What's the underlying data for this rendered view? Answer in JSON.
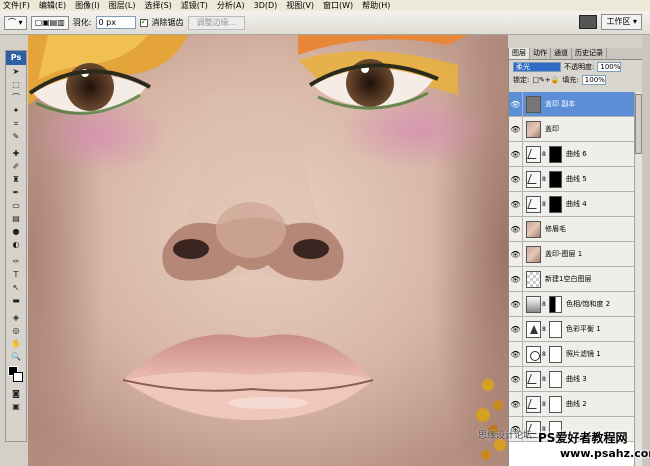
{
  "menu": [
    "文件(F)",
    "编辑(E)",
    "图像(I)",
    "图层(L)",
    "选择(S)",
    "滤镜(T)",
    "分析(A)",
    "3D(D)",
    "视图(V)",
    "窗口(W)",
    "帮助(H)"
  ],
  "options": {
    "feather_label": "羽化:",
    "feather_value": "0 px",
    "antialias_label": "消除锯齿",
    "refine_edge": "调整边缘..."
  },
  "workspace": {
    "label": "工作区 ▾"
  },
  "toolbox": {
    "logo": "Ps"
  },
  "layers_panel": {
    "tabs": [
      "图层",
      "动作",
      "通道",
      "历史记录"
    ],
    "blend_mode": "柔光",
    "opacity_label": "不透明度:",
    "opacity_value": "100%",
    "lock_label": "锁定:",
    "fill_label": "填充:",
    "fill_value": "100%",
    "layers": [
      {
        "name": "盖印 副本",
        "thumb": "gray",
        "mask": "",
        "selected": true
      },
      {
        "name": "盖印",
        "thumb": "photo",
        "mask": "",
        "selected": false
      },
      {
        "name": "曲线 6",
        "thumb": "curve",
        "mask": "black",
        "selected": false
      },
      {
        "name": "曲线 5",
        "thumb": "curve",
        "mask": "black",
        "selected": false
      },
      {
        "name": "曲线 4",
        "thumb": "curve",
        "mask": "black",
        "selected": false
      },
      {
        "name": "修眉毛",
        "thumb": "photo",
        "mask": "",
        "selected": false
      },
      {
        "name": "盖印-图层 1",
        "thumb": "photo",
        "mask": "",
        "selected": false
      },
      {
        "name": "新建1空白图层",
        "thumb": "check",
        "mask": "",
        "selected": false
      },
      {
        "name": "色相/饱和度 2",
        "thumb": "hue",
        "mask": "split",
        "selected": false
      },
      {
        "name": "色彩平衡 1",
        "thumb": "bal",
        "mask": "white",
        "selected": false
      },
      {
        "name": "照片滤镜 1",
        "thumb": "filt",
        "mask": "white",
        "selected": false
      },
      {
        "name": "曲线 3",
        "thumb": "curve",
        "mask": "white",
        "selected": false
      },
      {
        "name": "曲线 2",
        "thumb": "curve",
        "mask": "white",
        "selected": false
      },
      {
        "name": "",
        "thumb": "curve",
        "mask": "white",
        "selected": false
      }
    ]
  },
  "watermark": {
    "left": "思缘设计论坛",
    "brand": "PS爱好者教程网",
    "url": "www.psahz.com"
  }
}
